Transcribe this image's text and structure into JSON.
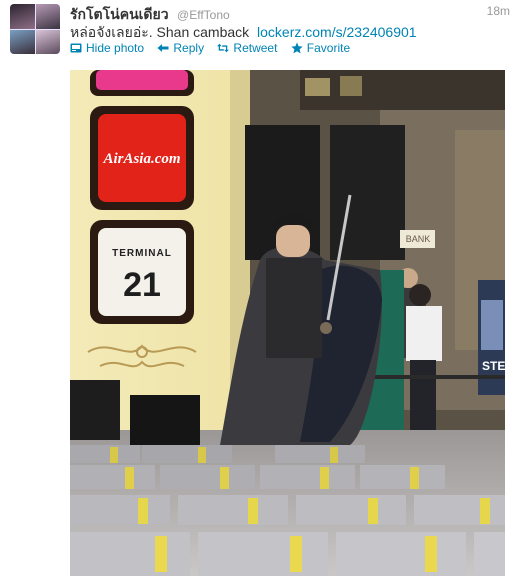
{
  "tweet": {
    "display_name": "รักโตโน่คนเดียว",
    "screen_name": "@EffTono",
    "timestamp": "18m",
    "text": "หล่อจังเลยอ่ะ. Shan camback",
    "link": "lockerz.com/s/232406901",
    "actions": {
      "hide_photo": "Hide photo",
      "reply": "Reply",
      "retweet": "Retweet",
      "favorite": "Favorite"
    }
  },
  "photo": {
    "sign_brand": "AirAsia.com",
    "terminal_label": "TERMINAL",
    "terminal_number": "21",
    "bank_sign": "BANK",
    "poster_text": "STE"
  },
  "colors": {
    "link": "#0084b4",
    "muted": "#999999",
    "text": "#333333",
    "airasia_red": "#e2231a",
    "sign_frame": "#2a1a12"
  },
  "icons": [
    "photo-icon",
    "reply-arrow-icon",
    "retweet-icon",
    "star-icon"
  ]
}
